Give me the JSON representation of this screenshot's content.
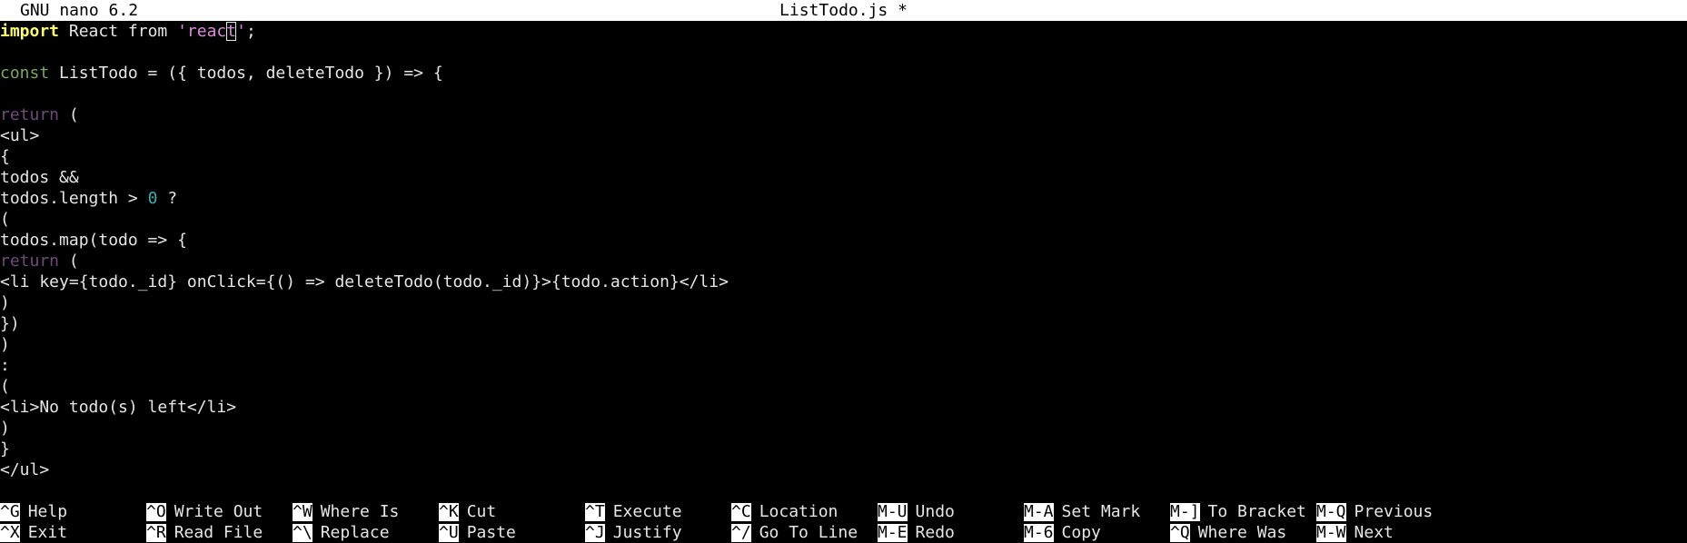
{
  "titlebar": {
    "app_version": "GNU nano 6.2",
    "filename": "ListTodo.js *"
  },
  "editor": {
    "lines": [
      [
        {
          "t": "import",
          "c": "import"
        },
        {
          "t": " React from ",
          "c": "plain"
        },
        {
          "t": "'reac",
          "c": "string"
        },
        {
          "t": "t",
          "c": "string",
          "cursor": true
        },
        {
          "t": "'",
          "c": "string"
        },
        {
          "t": ";",
          "c": "plain"
        }
      ],
      [],
      [
        {
          "t": "const",
          "c": "keyword"
        },
        {
          "t": " ListTodo = ({ todos, deleteTodo }) => {",
          "c": "plain"
        }
      ],
      [],
      [
        {
          "t": "return",
          "c": "return"
        },
        {
          "t": " (",
          "c": "plain"
        }
      ],
      [
        {
          "t": "<ul>",
          "c": "plain"
        }
      ],
      [
        {
          "t": "{",
          "c": "plain"
        }
      ],
      [
        {
          "t": "todos &&",
          "c": "plain"
        }
      ],
      [
        {
          "t": "todos.length > ",
          "c": "plain"
        },
        {
          "t": "0",
          "c": "number"
        },
        {
          "t": " ?",
          "c": "plain"
        }
      ],
      [
        {
          "t": "(",
          "c": "plain"
        }
      ],
      [
        {
          "t": "todos.map(todo => {",
          "c": "plain"
        }
      ],
      [
        {
          "t": "return",
          "c": "return"
        },
        {
          "t": " (",
          "c": "plain"
        }
      ],
      [
        {
          "t": "<li key={todo._id} onClick={() => deleteTodo(todo._id)}>{todo.action}</li>",
          "c": "plain"
        }
      ],
      [
        {
          "t": ")",
          "c": "plain"
        }
      ],
      [
        {
          "t": "})",
          "c": "plain"
        }
      ],
      [
        {
          "t": ")",
          "c": "plain"
        }
      ],
      [
        {
          "t": ":",
          "c": "plain"
        }
      ],
      [
        {
          "t": "(",
          "c": "plain"
        }
      ],
      [
        {
          "t": "<li>No todo(s) left</li>",
          "c": "plain"
        }
      ],
      [
        {
          "t": ")",
          "c": "plain"
        }
      ],
      [
        {
          "t": "}",
          "c": "plain"
        }
      ],
      [
        {
          "t": "</ul>",
          "c": "plain"
        }
      ]
    ]
  },
  "shortcuts": {
    "row1": [
      {
        "key": "^G",
        "label": "Help"
      },
      {
        "key": "^O",
        "label": "Write Out"
      },
      {
        "key": "^W",
        "label": "Where Is"
      },
      {
        "key": "^K",
        "label": "Cut"
      },
      {
        "key": "^T",
        "label": "Execute"
      },
      {
        "key": "^C",
        "label": "Location"
      },
      {
        "key": "M-U",
        "label": "Undo"
      },
      {
        "key": "M-A",
        "label": "Set Mark"
      },
      {
        "key": "M-]",
        "label": "To Bracket"
      },
      {
        "key": "M-Q",
        "label": "Previous"
      }
    ],
    "row2": [
      {
        "key": "^X",
        "label": "Exit"
      },
      {
        "key": "^R",
        "label": "Read File"
      },
      {
        "key": "^\\",
        "label": "Replace"
      },
      {
        "key": "^U",
        "label": "Paste"
      },
      {
        "key": "^J",
        "label": "Justify"
      },
      {
        "key": "^/",
        "label": "Go To Line"
      },
      {
        "key": "M-E",
        "label": "Redo"
      },
      {
        "key": "M-6",
        "label": "Copy"
      },
      {
        "key": "^Q",
        "label": "Where Was"
      },
      {
        "key": "M-W",
        "label": "Next"
      }
    ]
  },
  "colors": {
    "import": "#ffff66",
    "keyword": "#7ba85a",
    "return": "#6e4b7a",
    "string": "#d98cd9",
    "number": "#33b3b3",
    "text": "#e6e6e6",
    "background": "#000000"
  }
}
